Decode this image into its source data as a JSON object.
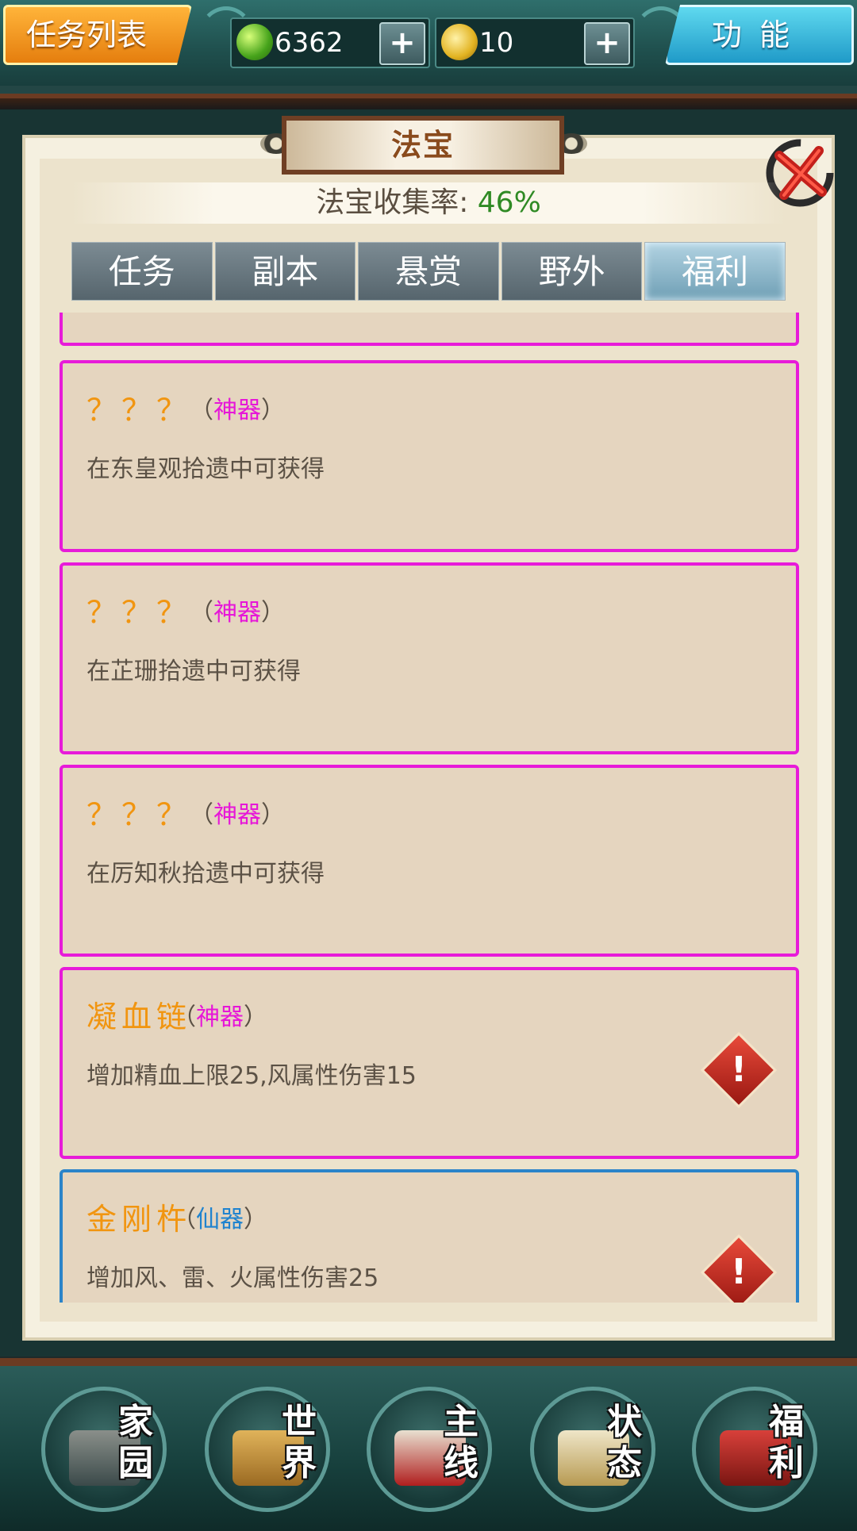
{
  "topbar": {
    "task_list_label": "任务列表",
    "function_label": "功能",
    "jade_amount": "6362",
    "gold_amount": "10",
    "plus": "+"
  },
  "panel": {
    "title": "法宝",
    "collect_label": "法宝收集率:",
    "collect_value": "46%"
  },
  "tabs": [
    {
      "label": "任务",
      "active": false
    },
    {
      "label": "副本",
      "active": false
    },
    {
      "label": "悬赏",
      "active": false
    },
    {
      "label": "野外",
      "active": false
    },
    {
      "label": "福利",
      "active": true
    }
  ],
  "items": [
    {
      "name": "？？？",
      "open": "（",
      "grade": "神器",
      "close": "）",
      "desc": "在东皇观拾遗中可获得",
      "warn": false
    },
    {
      "name": "？？？",
      "open": "（",
      "grade": "神器",
      "close": "）",
      "desc": "在芷珊拾遗中可获得",
      "warn": false
    },
    {
      "name": "？？？",
      "open": "（",
      "grade": "神器",
      "close": "）",
      "desc": "在厉知秋拾遗中可获得",
      "warn": false
    },
    {
      "name": "凝血链",
      "open": "（",
      "grade": "神器",
      "close": "）",
      "desc": "增加精血上限25,风属性伤害15",
      "warn": true
    },
    {
      "name": "金刚杵",
      "open": "（",
      "grade": "仙器",
      "close": "）",
      "desc": "增加风、雷、火属性伤害25",
      "warn": true
    }
  ],
  "warn_symbol": "!",
  "nav": [
    {
      "top": "家",
      "bottom": "园",
      "icon": "home-icon"
    },
    {
      "top": "世",
      "bottom": "界",
      "icon": "world-map-icon"
    },
    {
      "top": "主",
      "bottom": "线",
      "icon": "main-quest-icon"
    },
    {
      "top": "状",
      "bottom": "态",
      "icon": "status-icon"
    },
    {
      "top": "福",
      "bottom": "利",
      "icon": "welfare-bag-icon"
    }
  ],
  "colors": {
    "grade_divine": "#e617d8",
    "grade_immortal": "#1f83cf",
    "item_name": "#f19510",
    "collect_value": "#2f8a24"
  }
}
